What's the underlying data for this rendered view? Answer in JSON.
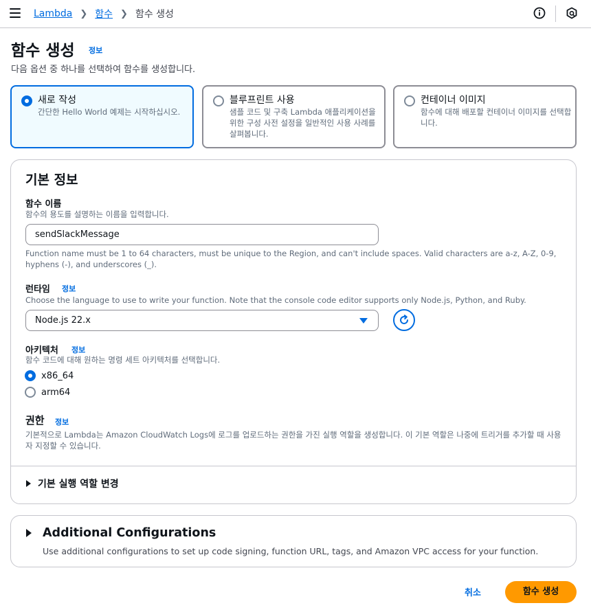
{
  "breadcrumb": {
    "root": "Lambda",
    "parent": "함수",
    "current": "함수 생성"
  },
  "header": {
    "title": "함수 생성",
    "info": "정보",
    "description": "다음 옵션 중 하나를 선택하여 함수를 생성합니다."
  },
  "options": [
    {
      "title": "새로 작성",
      "description": "간단한 Hello World 예제는 시작하십시오.",
      "selected": true
    },
    {
      "title": "블루프린트 사용",
      "description": "샘플 코드 및 구축 Lambda 애플리케이션을 위한 구성 사전 설정을 일반적인 사용 사례를 살펴봅니다.",
      "selected": false
    },
    {
      "title": "컨테이너 이미지",
      "description": "함수에 대해 배포할 컨테이너 이미지를 선택합니다.",
      "selected": false
    }
  ],
  "basic_info": {
    "title": "기본 정보",
    "function_name": {
      "label": "함수 이름",
      "hint": "함수의 용도를 설명하는 이름을 입력합니다.",
      "value": "sendSlackMessage",
      "constraint": "Function name must be 1 to 64 characters, must be unique to the Region, and can't include spaces. Valid characters are a-z, A-Z, 0-9, hyphens (-), and underscores (_)."
    },
    "runtime": {
      "label": "런타임",
      "info": "정보",
      "hint": "Choose the language to use to write your function. Note that the console code editor supports only Node.js, Python, and Ruby.",
      "value": "Node.js 22.x"
    },
    "architecture": {
      "label": "아키텍처",
      "info": "정보",
      "hint": "함수 코드에 대해 원하는 명령 세트 아키텍처를 선택합니다.",
      "options": [
        "x86_64",
        "arm64"
      ],
      "selected": "x86_64"
    },
    "permissions": {
      "label": "권한",
      "info": "정보",
      "hint": "기본적으로 Lambda는 Amazon CloudWatch Logs에 로그를 업로드하는 권한을 가진 실행 역할을 생성합니다. 이 기본 역할은 나중에 트리거를 추가할 때 사용자 지정할 수 있습니다."
    },
    "role_expander": "기본 실행 역할 변경"
  },
  "additional": {
    "title": "Additional Configurations",
    "description": "Use additional configurations to set up code signing, function URL, tags, and Amazon VPC access for your function."
  },
  "footer": {
    "cancel": "취소",
    "create": "함수 생성"
  },
  "colors": {
    "link": "#006ce0",
    "primary_button": "#ff9900",
    "selected_tile_bg": "#f0fbff"
  }
}
